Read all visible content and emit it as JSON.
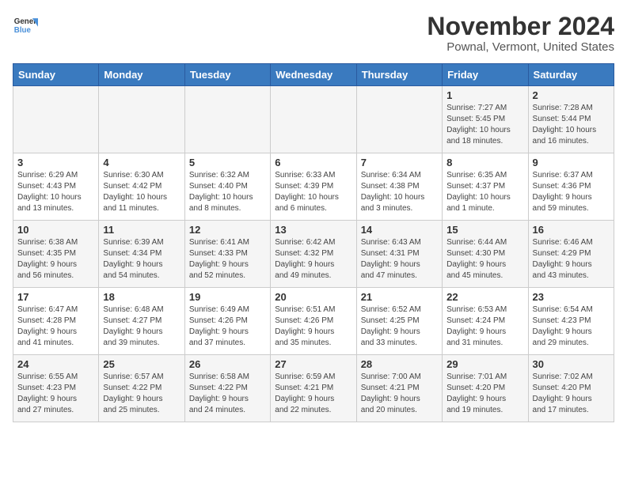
{
  "header": {
    "logo_line1": "General",
    "logo_line2": "Blue",
    "title": "November 2024",
    "subtitle": "Pownal, Vermont, United States"
  },
  "weekdays": [
    "Sunday",
    "Monday",
    "Tuesday",
    "Wednesday",
    "Thursday",
    "Friday",
    "Saturday"
  ],
  "weeks": [
    [
      {
        "day": "",
        "info": ""
      },
      {
        "day": "",
        "info": ""
      },
      {
        "day": "",
        "info": ""
      },
      {
        "day": "",
        "info": ""
      },
      {
        "day": "",
        "info": ""
      },
      {
        "day": "1",
        "info": "Sunrise: 7:27 AM\nSunset: 5:45 PM\nDaylight: 10 hours\nand 18 minutes."
      },
      {
        "day": "2",
        "info": "Sunrise: 7:28 AM\nSunset: 5:44 PM\nDaylight: 10 hours\nand 16 minutes."
      }
    ],
    [
      {
        "day": "3",
        "info": "Sunrise: 6:29 AM\nSunset: 4:43 PM\nDaylight: 10 hours\nand 13 minutes."
      },
      {
        "day": "4",
        "info": "Sunrise: 6:30 AM\nSunset: 4:42 PM\nDaylight: 10 hours\nand 11 minutes."
      },
      {
        "day": "5",
        "info": "Sunrise: 6:32 AM\nSunset: 4:40 PM\nDaylight: 10 hours\nand 8 minutes."
      },
      {
        "day": "6",
        "info": "Sunrise: 6:33 AM\nSunset: 4:39 PM\nDaylight: 10 hours\nand 6 minutes."
      },
      {
        "day": "7",
        "info": "Sunrise: 6:34 AM\nSunset: 4:38 PM\nDaylight: 10 hours\nand 3 minutes."
      },
      {
        "day": "8",
        "info": "Sunrise: 6:35 AM\nSunset: 4:37 PM\nDaylight: 10 hours\nand 1 minute."
      },
      {
        "day": "9",
        "info": "Sunrise: 6:37 AM\nSunset: 4:36 PM\nDaylight: 9 hours\nand 59 minutes."
      }
    ],
    [
      {
        "day": "10",
        "info": "Sunrise: 6:38 AM\nSunset: 4:35 PM\nDaylight: 9 hours\nand 56 minutes."
      },
      {
        "day": "11",
        "info": "Sunrise: 6:39 AM\nSunset: 4:34 PM\nDaylight: 9 hours\nand 54 minutes."
      },
      {
        "day": "12",
        "info": "Sunrise: 6:41 AM\nSunset: 4:33 PM\nDaylight: 9 hours\nand 52 minutes."
      },
      {
        "day": "13",
        "info": "Sunrise: 6:42 AM\nSunset: 4:32 PM\nDaylight: 9 hours\nand 49 minutes."
      },
      {
        "day": "14",
        "info": "Sunrise: 6:43 AM\nSunset: 4:31 PM\nDaylight: 9 hours\nand 47 minutes."
      },
      {
        "day": "15",
        "info": "Sunrise: 6:44 AM\nSunset: 4:30 PM\nDaylight: 9 hours\nand 45 minutes."
      },
      {
        "day": "16",
        "info": "Sunrise: 6:46 AM\nSunset: 4:29 PM\nDaylight: 9 hours\nand 43 minutes."
      }
    ],
    [
      {
        "day": "17",
        "info": "Sunrise: 6:47 AM\nSunset: 4:28 PM\nDaylight: 9 hours\nand 41 minutes."
      },
      {
        "day": "18",
        "info": "Sunrise: 6:48 AM\nSunset: 4:27 PM\nDaylight: 9 hours\nand 39 minutes."
      },
      {
        "day": "19",
        "info": "Sunrise: 6:49 AM\nSunset: 4:26 PM\nDaylight: 9 hours\nand 37 minutes."
      },
      {
        "day": "20",
        "info": "Sunrise: 6:51 AM\nSunset: 4:26 PM\nDaylight: 9 hours\nand 35 minutes."
      },
      {
        "day": "21",
        "info": "Sunrise: 6:52 AM\nSunset: 4:25 PM\nDaylight: 9 hours\nand 33 minutes."
      },
      {
        "day": "22",
        "info": "Sunrise: 6:53 AM\nSunset: 4:24 PM\nDaylight: 9 hours\nand 31 minutes."
      },
      {
        "day": "23",
        "info": "Sunrise: 6:54 AM\nSunset: 4:23 PM\nDaylight: 9 hours\nand 29 minutes."
      }
    ],
    [
      {
        "day": "24",
        "info": "Sunrise: 6:55 AM\nSunset: 4:23 PM\nDaylight: 9 hours\nand 27 minutes."
      },
      {
        "day": "25",
        "info": "Sunrise: 6:57 AM\nSunset: 4:22 PM\nDaylight: 9 hours\nand 25 minutes."
      },
      {
        "day": "26",
        "info": "Sunrise: 6:58 AM\nSunset: 4:22 PM\nDaylight: 9 hours\nand 24 minutes."
      },
      {
        "day": "27",
        "info": "Sunrise: 6:59 AM\nSunset: 4:21 PM\nDaylight: 9 hours\nand 22 minutes."
      },
      {
        "day": "28",
        "info": "Sunrise: 7:00 AM\nSunset: 4:21 PM\nDaylight: 9 hours\nand 20 minutes."
      },
      {
        "day": "29",
        "info": "Sunrise: 7:01 AM\nSunset: 4:20 PM\nDaylight: 9 hours\nand 19 minutes."
      },
      {
        "day": "30",
        "info": "Sunrise: 7:02 AM\nSunset: 4:20 PM\nDaylight: 9 hours\nand 17 minutes."
      }
    ]
  ]
}
